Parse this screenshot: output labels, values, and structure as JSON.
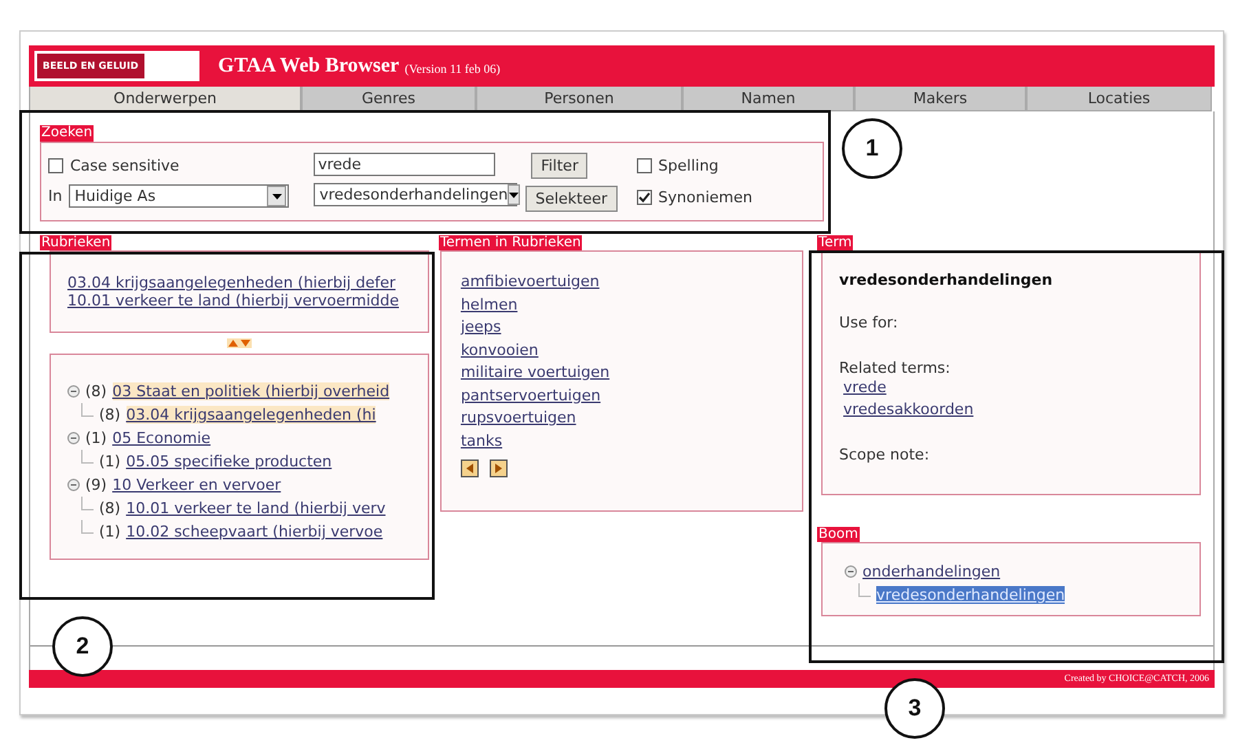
{
  "header": {
    "logo": "BEELD EN GELUID",
    "title": "GTAA Web Browser",
    "version": "(Version 11 feb 06)"
  },
  "tabs": [
    {
      "label": "Onderwerpen",
      "selected": true
    },
    {
      "label": "Genres",
      "selected": false
    },
    {
      "label": "Personen",
      "selected": false
    },
    {
      "label": "Namen",
      "selected": false
    },
    {
      "label": "Makers",
      "selected": false
    },
    {
      "label": "Locaties",
      "selected": false
    }
  ],
  "search": {
    "label": "Zoeken",
    "case_sensitive": {
      "label": "Case sensitive",
      "checked": false
    },
    "in_label": "In",
    "in_value": "Huidige As",
    "query": "vrede",
    "result_value": "vredesonderhandelingen",
    "filter_button": "Filter",
    "select_button": "Selekteer",
    "spelling": {
      "label": "Spelling",
      "checked": false
    },
    "synoniemen": {
      "label": "Synoniemen",
      "checked": true
    }
  },
  "rubrieken": {
    "label": "Rubrieken",
    "items": [
      "03.04 krijgsaangelegenheden (hierbij defer",
      "10.01 verkeer te land (hierbij vervoermidde"
    ],
    "tree": [
      {
        "count": "(8)",
        "label": "03 Staat en politiek (hierbij overheid",
        "highlighted": true,
        "expanded": true,
        "children": [
          {
            "count": "(8)",
            "label": "03.04 krijgsaangelegenheden (hi",
            "highlighted": true
          }
        ]
      },
      {
        "count": "(1)",
        "label": "05 Economie",
        "highlighted": false,
        "expanded": true,
        "children": [
          {
            "count": "(1)",
            "label": "05.05 specifieke producten",
            "highlighted": false
          }
        ]
      },
      {
        "count": "(9)",
        "label": "10 Verkeer en vervoer",
        "highlighted": false,
        "expanded": true,
        "children": [
          {
            "count": "(8)",
            "label": "10.01 verkeer te land (hierbij verv",
            "highlighted": false
          },
          {
            "count": "(1)",
            "label": "10.02 scheepvaart (hierbij vervoe",
            "highlighted": false
          }
        ]
      }
    ]
  },
  "termen": {
    "label": "Termen in Rubrieken",
    "items": [
      "amfibievoertuigen",
      "helmen",
      "jeeps",
      "konvooien",
      "militaire voertuigen",
      "pantservoertuigen",
      "rupsvoertuigen",
      "tanks"
    ]
  },
  "term": {
    "label": "Term",
    "name": "vredesonderhandelingen",
    "use_for": "Use for:",
    "related_label": "Related terms:",
    "related": [
      "vrede",
      "vredesakkoorden"
    ],
    "scope_note": "Scope note:"
  },
  "boom": {
    "label": "Boom",
    "tree": [
      {
        "label": "onderhandelingen",
        "selected": false,
        "expanded": true,
        "children": [
          {
            "label": "vredesonderhandelingen",
            "selected": true
          }
        ]
      }
    ]
  },
  "footer": "Created by CHOICE@CATCH, 2006",
  "annotations": [
    {
      "number": "1"
    },
    {
      "number": "2"
    },
    {
      "number": "3"
    }
  ]
}
